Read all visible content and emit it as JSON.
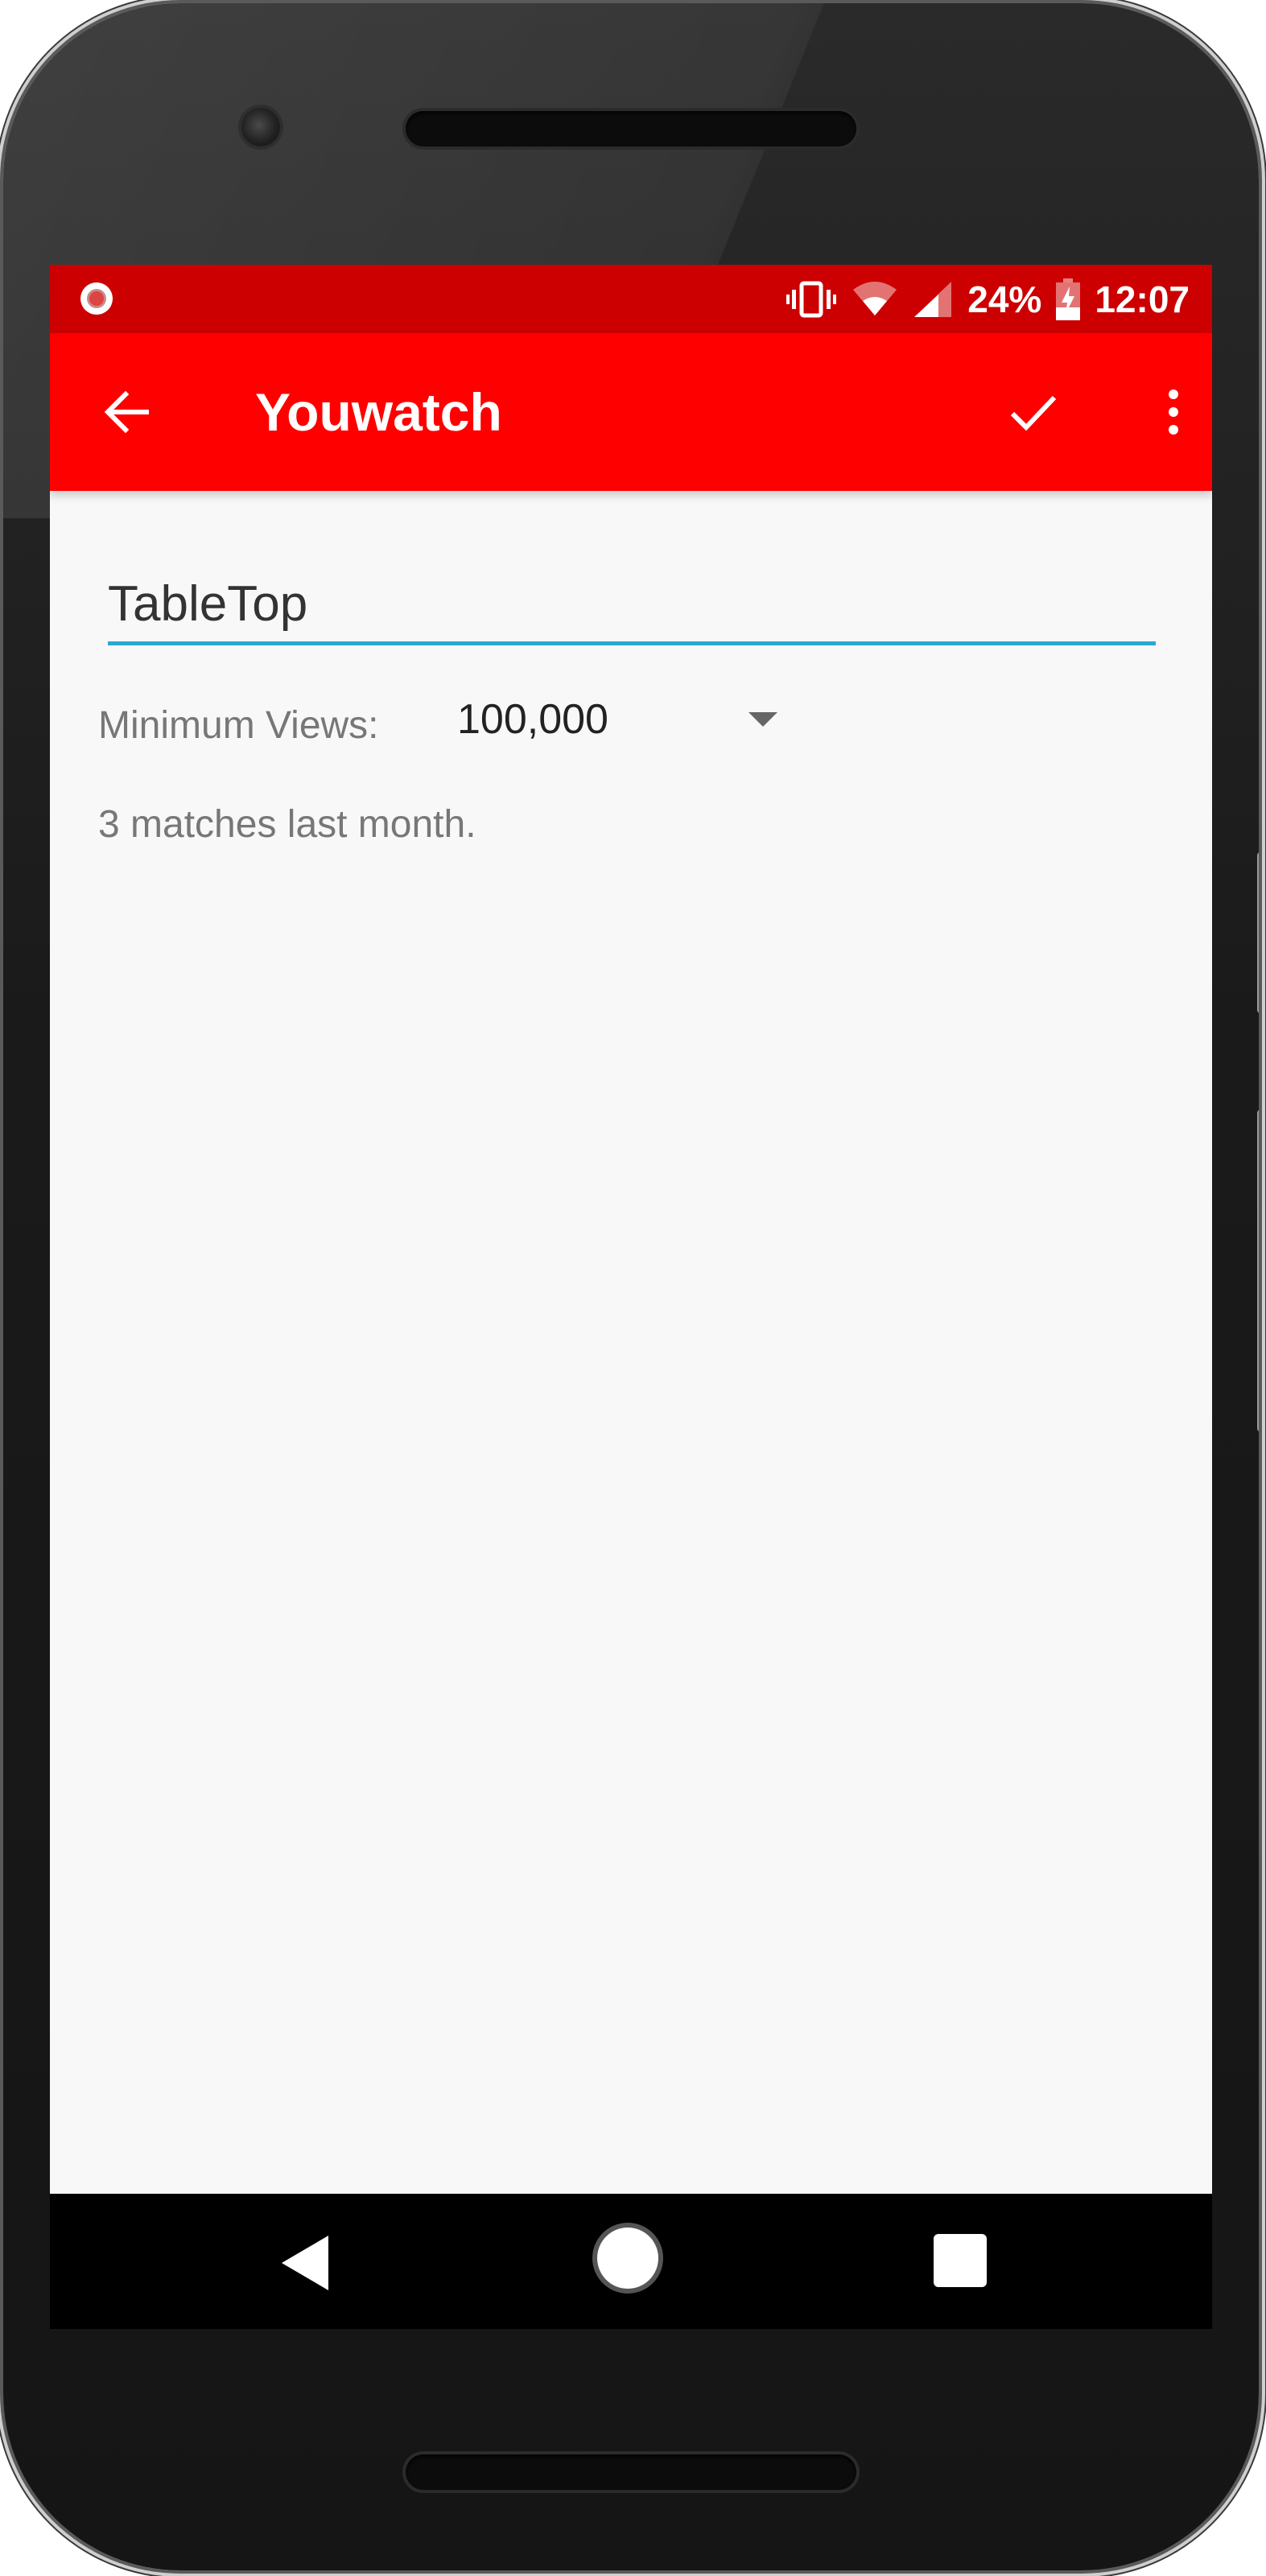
{
  "status_bar": {
    "battery_percent": "24%",
    "time": "12:07",
    "icons": [
      "recording-icon",
      "vibrate-icon",
      "wifi-icon",
      "cell-signal-icon",
      "battery-charging-icon"
    ]
  },
  "app_bar": {
    "title": "Youwatch",
    "color": "#ff0000",
    "status_color": "#cc0000",
    "icons": [
      "back-arrow-icon",
      "checkmark-icon",
      "more-vert-icon"
    ]
  },
  "form": {
    "name_value": "TableTop",
    "accent_color": "#2ba8d3",
    "min_views_label": "Minimum Views:",
    "min_views_value": "100,000",
    "matches_text": "3 matches last month."
  },
  "nav_bar": {
    "icons": [
      "nav-back-icon",
      "nav-home-icon",
      "nav-recents-icon"
    ]
  }
}
